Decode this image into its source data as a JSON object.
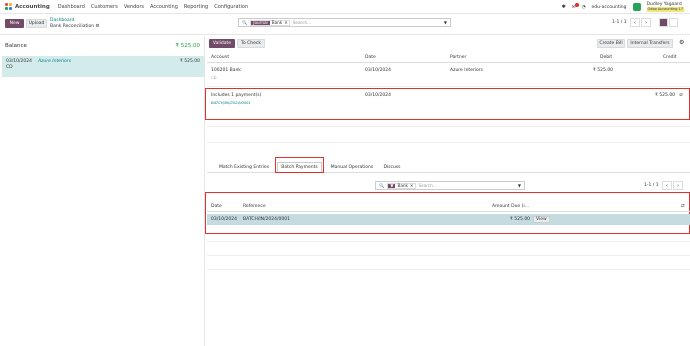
{
  "nav": {
    "app_name": "Accounting",
    "menu": [
      "Dashboard",
      "Customers",
      "Vendors",
      "Accounting",
      "Reporting",
      "Configuration"
    ],
    "company": "edu-accounting",
    "user_name": "Dudley Yagaard",
    "user_sub": "Odoo Accounting 17"
  },
  "control": {
    "new_label": "New",
    "upload_label": "Upload",
    "breadcrumb_parent": "Dashboard",
    "breadcrumb_current": "Bank Reconciliation",
    "facet_key": "Journal",
    "facet_value": "Bank",
    "search_placeholder": "Search...",
    "pager": "1-1 / 1"
  },
  "left": {
    "balance_label": "Balance",
    "balance_amount": "₹ 525.00",
    "line_date": "03/10/2024",
    "line_ref": "Azure Interiors",
    "line_sub": "CD",
    "line_amount": "₹ 525.00"
  },
  "right": {
    "validate_label": "Validate",
    "to_check_label": "To Check",
    "create_bill_label": "Create Bill",
    "internal_transfer_label": "Internal Transfers",
    "headers": {
      "account": "Account",
      "date": "Date",
      "partner": "Partner",
      "debit": "Debit",
      "credit": "Credit"
    },
    "row1": {
      "account": "100201 Bank",
      "sub": "CD",
      "date": "03/10/2024",
      "partner": "Azure Interiors",
      "debit": "₹ 525.00"
    },
    "row2": {
      "account": "Includes 1 payment(s)",
      "sub": "BATCH/IN/2024/0001",
      "date": "03/10/2024",
      "credit": "₹ 525.00"
    }
  },
  "tabs": [
    "Match Existing Entries",
    "Batch Payments",
    "Manual Operations",
    "Discuss"
  ],
  "batch": {
    "facet_value": "Bank",
    "search_placeholder": "Search...",
    "pager": "1-1 / 1",
    "headers": {
      "date": "Date",
      "reference": "Reference",
      "amount": "Amount Due (i..."
    },
    "row": {
      "date": "03/10/2024",
      "reference": "BATCH/IN/2024/0001",
      "amount": "₹ 525.00",
      "view": "View"
    }
  },
  "colors": {
    "primary": "#714b67",
    "teal": "#017e84",
    "highlight": "#e03131",
    "selected": "#c4dbe0"
  }
}
